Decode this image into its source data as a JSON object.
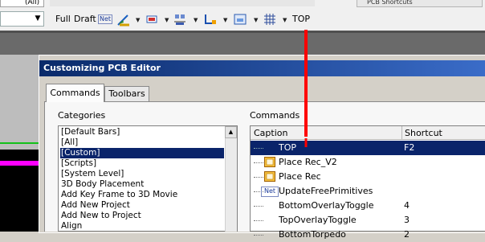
{
  "toolbar": {
    "combo_top_value": "(All)",
    "full_label": "Full",
    "draft_label": "Draft",
    "net_label": "Net",
    "top_label": "TOP",
    "dropdown_arrow": "▼",
    "pcb_shortcuts_panel": "PCB Shortcuts"
  },
  "dialog": {
    "title": "Customizing PCB Editor",
    "tabs": [
      "Commands",
      "Toolbars"
    ],
    "categories_label": "Categories",
    "commands_label": "Commands",
    "categories": [
      "[Default Bars]",
      "[All]",
      "[Custom]",
      "[Scripts]",
      "[System Level]",
      "3D Body Placement",
      "Add Key Frame to 3D Movie",
      "Add New Project",
      "Add New to Project",
      "Align"
    ],
    "selected_category": "[Custom]",
    "scroll_up_arrow": "▲",
    "columns": {
      "caption": "Caption",
      "shortcut": "Shortcut"
    },
    "commands": [
      {
        "caption": "TOP",
        "shortcut": "F2",
        "icon": "none",
        "selected": true
      },
      {
        "caption": "Place Rec_V2",
        "shortcut": "",
        "icon": "rectangle-icon",
        "selected": false
      },
      {
        "caption": "Place Rec",
        "shortcut": "",
        "icon": "rectangle-icon",
        "selected": false
      },
      {
        "caption": "UpdateFreePrimitives",
        "shortcut": "",
        "icon": "net-icon",
        "selected": false
      },
      {
        "caption": "BottomOverlayToggle",
        "shortcut": "4",
        "icon": "none",
        "selected": false
      },
      {
        "caption": "TopOverlayToggle",
        "shortcut": "3",
        "icon": "none",
        "selected": false
      },
      {
        "caption": "BottomTorpedo",
        "shortcut": "2",
        "icon": "none",
        "selected": false
      }
    ]
  },
  "colors": {
    "selection": "#0a246a",
    "title_gradient_start": "#0a2a6a",
    "title_gradient_end": "#3a6cc8",
    "annotation_arrow": "#ff0000",
    "board_magenta": "#ff00ff",
    "board_green": "#13c11a"
  }
}
